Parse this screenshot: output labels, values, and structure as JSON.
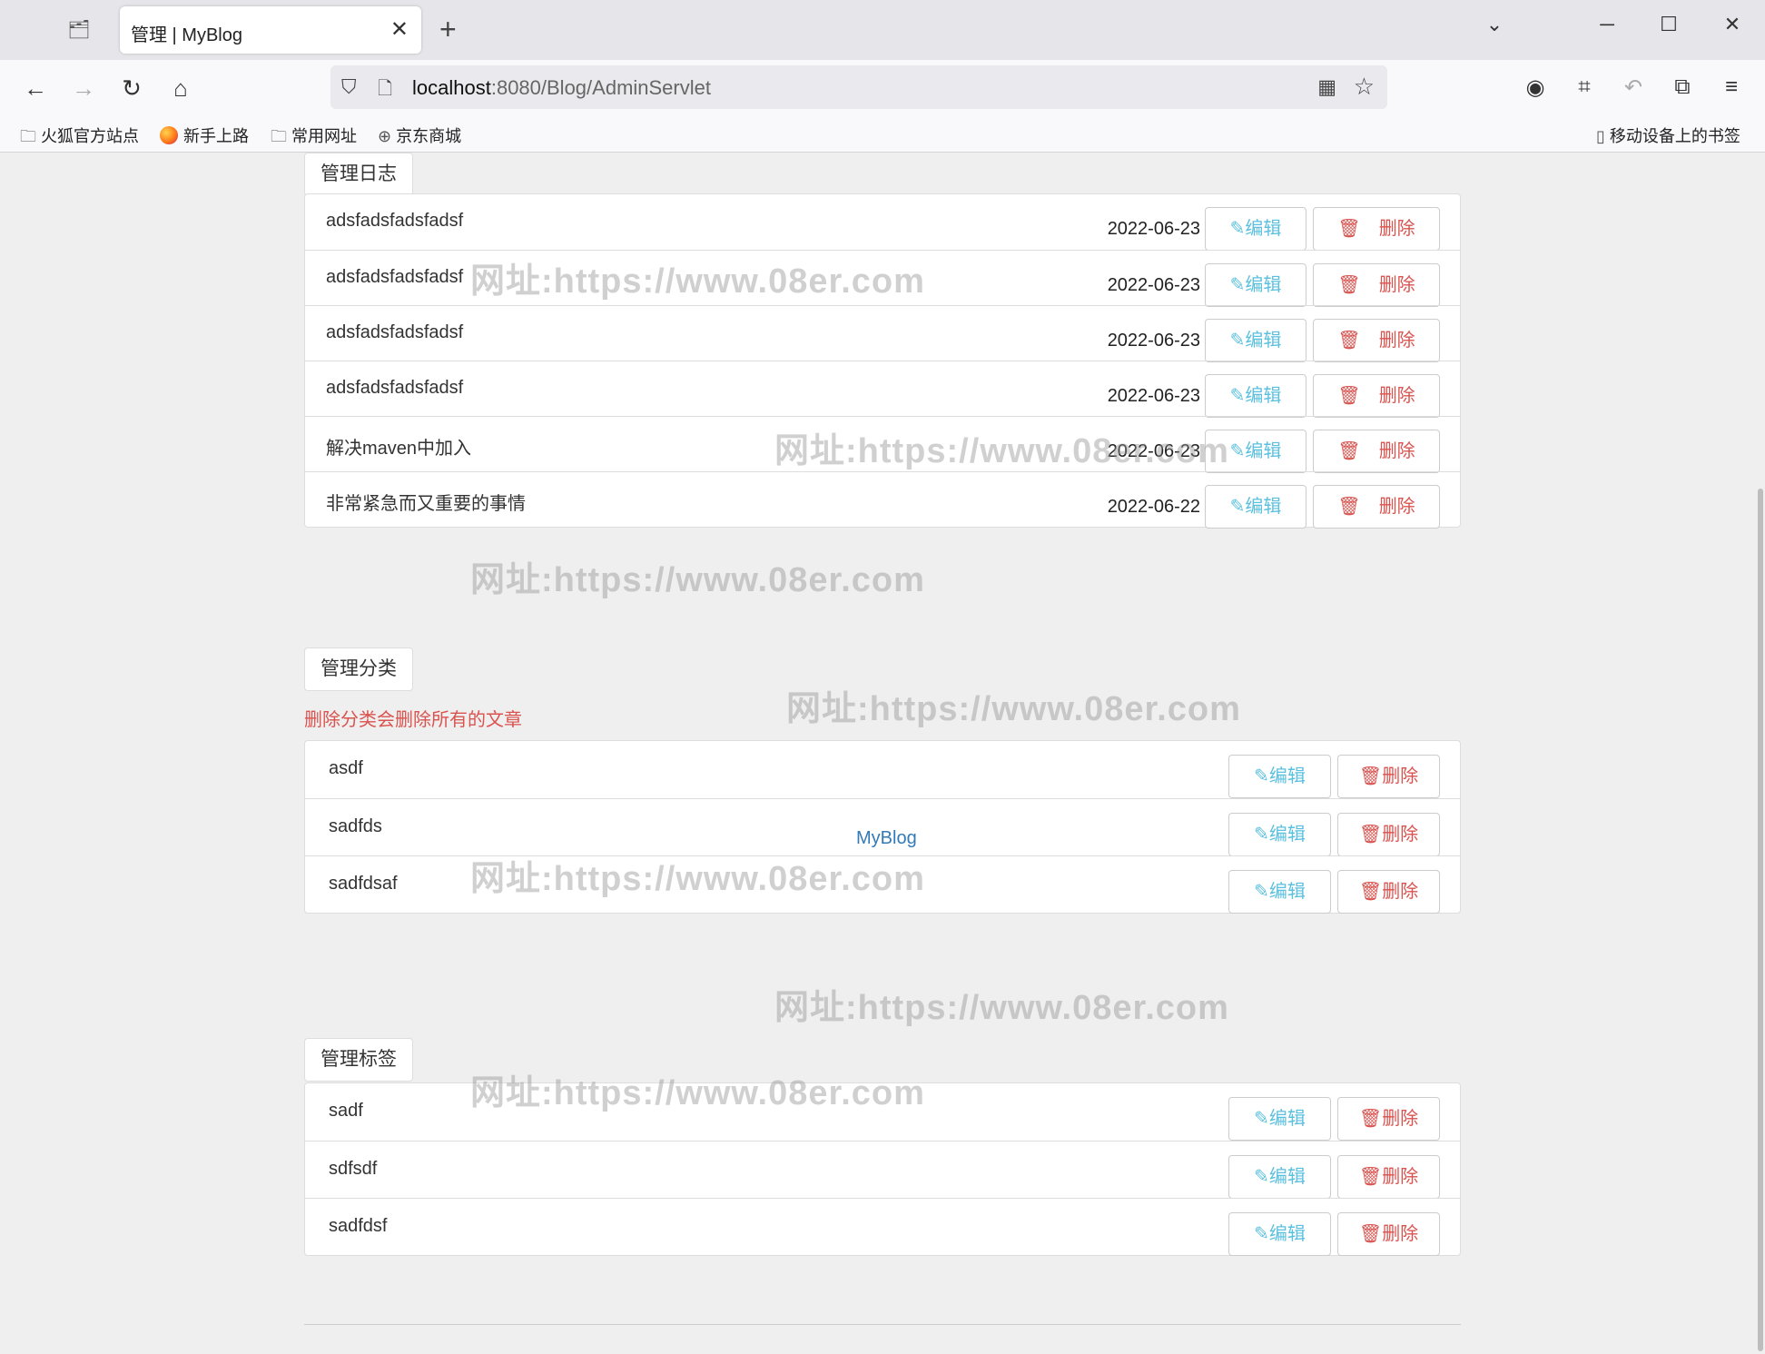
{
  "browser": {
    "tab_title": "管理 | MyBlog",
    "url_host": "localhost",
    "url_rest": ":8080/Blog/AdminServlet",
    "bookmarks": [
      "火狐官方站点",
      "新手上路",
      "常用网址",
      "京东商城"
    ],
    "mobile_bookmarks": "移动设备上的书签"
  },
  "posts_section": {
    "title": "管理日志",
    "edit_label": "编辑",
    "delete_label": "删除",
    "rows": [
      {
        "title": "adsfadsfadsfadsf",
        "date": "2022-06-23"
      },
      {
        "title": "adsfadsfadsfadsf",
        "date": "2022-06-23"
      },
      {
        "title": "adsfadsfadsfadsf",
        "date": "2022-06-23"
      },
      {
        "title": "adsfadsfadsfadsf",
        "date": "2022-06-23"
      },
      {
        "title": "解决maven中加入",
        "date": "2022-06-23"
      },
      {
        "title": "非常紧急而又重要的事情",
        "date": "2022-06-22"
      }
    ]
  },
  "categories_section": {
    "title": "管理分类",
    "warning": "删除分类会删除所有的文章",
    "edit_label": "编辑",
    "delete_label": "删除",
    "rows": [
      {
        "title": "asdf"
      },
      {
        "title": "sadfds"
      },
      {
        "title": "sadfdsaf"
      }
    ]
  },
  "tags_section": {
    "title": "管理标签",
    "edit_label": "编辑",
    "delete_label": "删除",
    "rows": [
      {
        "title": "sadf"
      },
      {
        "title": "sdfsdf"
      },
      {
        "title": "sadfdsf"
      }
    ]
  },
  "brand_link": "MyBlog",
  "watermark": "网址:https://www.08er.com",
  "colors": {
    "edit": "#5bc0de",
    "delete": "#d9534f",
    "link": "#337ab7"
  }
}
